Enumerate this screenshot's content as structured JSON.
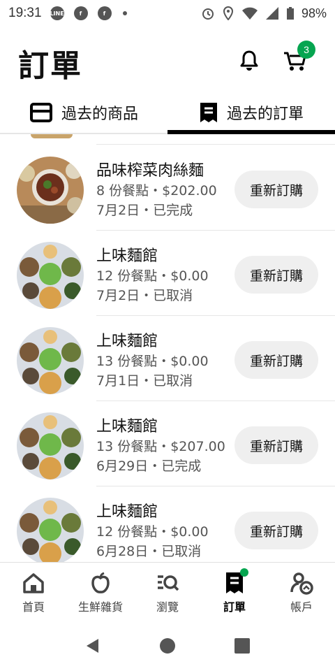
{
  "status_bar": {
    "time": "19:31",
    "battery": "98%"
  },
  "header": {
    "title": "訂單",
    "cart_count": "3"
  },
  "tabs": [
    {
      "label": "過去的商品",
      "active": false
    },
    {
      "label": "過去的訂單",
      "active": true
    }
  ],
  "orders": [
    {
      "name": "品味榨菜肉絲麵",
      "meta": "8 份餐點・$202.00",
      "status": "7月2日・已完成",
      "reorder": "重新訂購"
    },
    {
      "name": "上味麵館",
      "meta": "12 份餐點・$0.00",
      "status": "7月2日・已取消",
      "reorder": "重新訂購"
    },
    {
      "name": "上味麵館",
      "meta": "13 份餐點・$0.00",
      "status": "7月1日・已取消",
      "reorder": "重新訂購"
    },
    {
      "name": "上味麵館",
      "meta": "13 份餐點・$207.00",
      "status": "6月29日・已完成",
      "reorder": "重新訂購"
    },
    {
      "name": "上味麵館",
      "meta": "12 份餐點・$0.00",
      "status": "6月28日・已取消",
      "reorder": "重新訂購"
    }
  ],
  "bottom_nav": [
    {
      "label": "首頁",
      "icon": "home-icon",
      "active": false
    },
    {
      "label": "生鮮雜貨",
      "icon": "apple-icon",
      "active": false
    },
    {
      "label": "瀏覽",
      "icon": "browse-icon",
      "active": false
    },
    {
      "label": "訂單",
      "icon": "receipt-icon",
      "active": true
    },
    {
      "label": "帳戶",
      "icon": "account-icon",
      "active": false
    }
  ],
  "colors": {
    "accent_green": "#06a550",
    "pill_bg": "#efefef"
  }
}
